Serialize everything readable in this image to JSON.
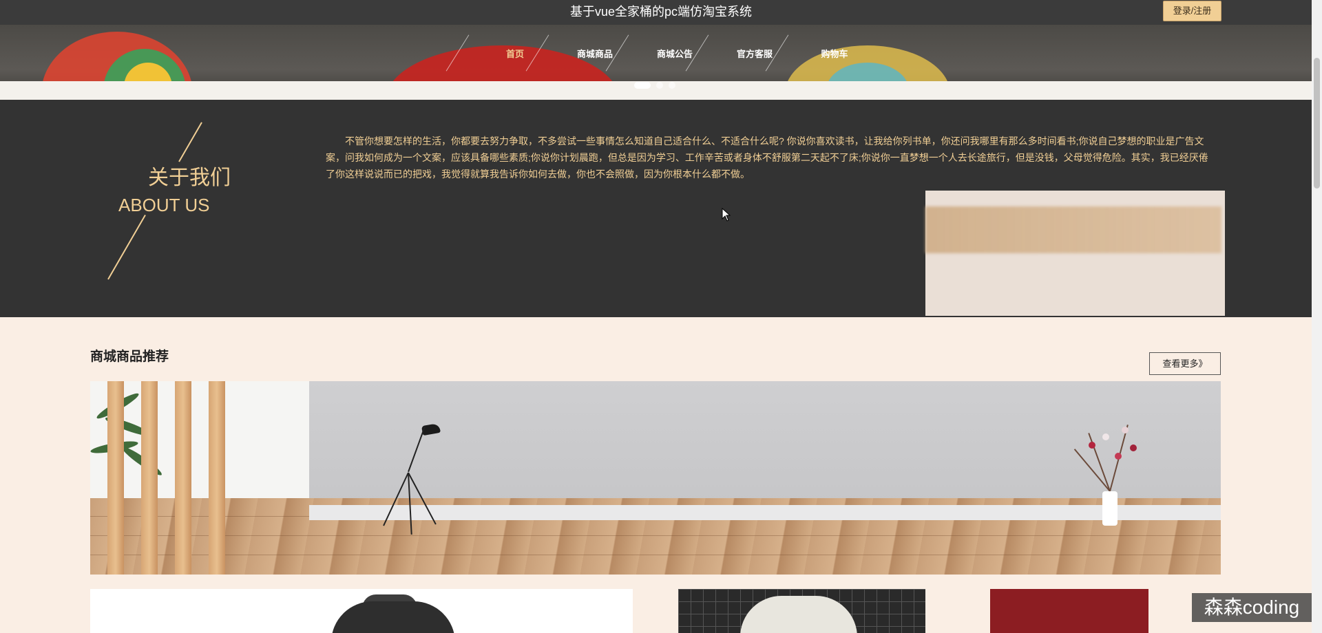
{
  "header": {
    "site_title": "基于vue全家桶的pc端仿淘宝系统",
    "login_label": "登录/注册"
  },
  "nav": {
    "items": [
      {
        "label": "首页",
        "active": true
      },
      {
        "label": "商城商品",
        "active": false
      },
      {
        "label": "商城公告",
        "active": false
      },
      {
        "label": "官方客服",
        "active": false
      },
      {
        "label": "购物车",
        "active": false
      }
    ]
  },
  "carousel": {
    "slide_count": 3,
    "active_index": 0
  },
  "about": {
    "title_cn": "关于我们",
    "title_en": "ABOUT US",
    "body": "不管你想要怎样的生活，你都要去努力争取，不多尝试一些事情怎么知道自己适合什么、不适合什么呢? 你说你喜欢读书，让我给你列书单，你还问我哪里有那么多时间看书;你说自己梦想的职业是广告文案，问我如何成为一个文案，应该具备哪些素质;你说你计划晨跑，但总是因为学习、工作辛苦或者身体不舒服第二天起不了床;你说你一直梦想一个人去长途旅行，但是没钱，父母觉得危险。其实，我已经厌倦了你这样说说而已的把戏，我觉得就算我告诉你如何去做，你也不会照做，因为你根本什么都不做。"
  },
  "products": {
    "section_title": "商城商品推荐",
    "more_label": "查看更多》"
  },
  "watermark": "森森coding",
  "colors": {
    "accent": "#f1cf95",
    "dark_bg": "#333333",
    "top_bar": "#3b3b3b",
    "page_bg": "#faeee4"
  }
}
